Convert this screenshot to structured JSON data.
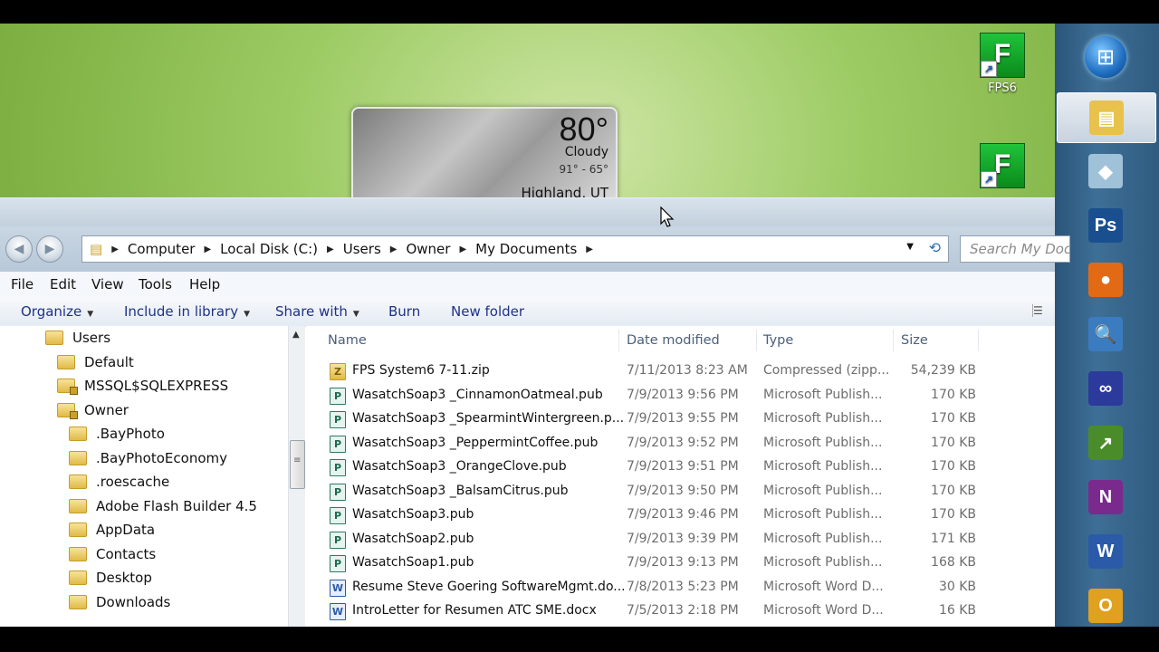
{
  "desktop": {
    "icons": [
      {
        "label": "FPS6",
        "glyph": "F"
      },
      {
        "label": "",
        "glyph": "F"
      }
    ],
    "weather": {
      "temp": "80°",
      "condition": "Cloudy",
      "range": "91° - 65°",
      "location": "Highland, UT"
    }
  },
  "taskbar": {
    "start_icon": "windows-orb-icon",
    "apps": [
      {
        "name": "windows-explorer-icon",
        "glyph": "▤",
        "color": "#e8c24a",
        "active": true
      },
      {
        "name": "eraser-app-icon",
        "glyph": "◆",
        "color": "#9fc2d9"
      },
      {
        "name": "photoshop-icon",
        "glyph": "Ps",
        "color": "#1a4f8f"
      },
      {
        "name": "firefox-icon",
        "glyph": "●",
        "color": "#e36a14"
      },
      {
        "name": "magnifier-icon",
        "glyph": "🔍",
        "color": "#3b7cc0"
      },
      {
        "name": "loop-app-icon",
        "glyph": "∞",
        "color": "#2b3a9b"
      },
      {
        "name": "excel-chart-icon",
        "glyph": "↗",
        "color": "#4a8c2a"
      },
      {
        "name": "onenote-icon",
        "glyph": "N",
        "color": "#7a2a8c"
      },
      {
        "name": "word-icon",
        "glyph": "W",
        "color": "#2a5aa8"
      },
      {
        "name": "outlook-icon",
        "glyph": "O",
        "color": "#e0a020"
      }
    ]
  },
  "explorer": {
    "breadcrumbs": [
      "Computer",
      "Local Disk (C:)",
      "Users",
      "Owner",
      "My Documents"
    ],
    "search_placeholder": "Search My Documents",
    "menu": [
      "File",
      "Edit",
      "View",
      "Tools",
      "Help"
    ],
    "commands": {
      "organize": "Organize",
      "include_in_library": "Include in library",
      "share_with": "Share with",
      "burn": "Burn",
      "new_folder": "New folder"
    },
    "tree": [
      {
        "label": "Users",
        "level": 0
      },
      {
        "label": "Default",
        "level": 1
      },
      {
        "label": "MSSQL$SQLEXPRESS",
        "level": 1,
        "locked": true
      },
      {
        "label": "Owner",
        "level": 1,
        "locked": true
      },
      {
        "label": ".BayPhoto",
        "level": 2
      },
      {
        "label": ".BayPhotoEconomy",
        "level": 2
      },
      {
        "label": ".roescache",
        "level": 2
      },
      {
        "label": "Adobe Flash Builder 4.5",
        "level": 2
      },
      {
        "label": "AppData",
        "level": 2
      },
      {
        "label": "Contacts",
        "level": 2
      },
      {
        "label": "Desktop",
        "level": 2
      },
      {
        "label": "Downloads",
        "level": 2
      }
    ],
    "columns": {
      "name": "Name",
      "date": "Date modified",
      "type": "Type",
      "size": "Size"
    },
    "files": [
      {
        "name": "FPS System6 7-11.zip",
        "date": "7/11/2013 8:23 AM",
        "type": "Compressed (zipp...",
        "size": "54,239 KB",
        "kind": "zip"
      },
      {
        "name": "WasatchSoap3 _CinnamonOatmeal.pub",
        "date": "7/9/2013 9:56 PM",
        "type": "Microsoft Publish...",
        "size": "170 KB",
        "kind": "pub"
      },
      {
        "name": "WasatchSoap3 _SpearmintWintergreen.p...",
        "date": "7/9/2013 9:55 PM",
        "type": "Microsoft Publish...",
        "size": "170 KB",
        "kind": "pub"
      },
      {
        "name": "WasatchSoap3 _PeppermintCoffee.pub",
        "date": "7/9/2013 9:52 PM",
        "type": "Microsoft Publish...",
        "size": "170 KB",
        "kind": "pub"
      },
      {
        "name": "WasatchSoap3 _OrangeClove.pub",
        "date": "7/9/2013 9:51 PM",
        "type": "Microsoft Publish...",
        "size": "170 KB",
        "kind": "pub"
      },
      {
        "name": "WasatchSoap3 _BalsamCitrus.pub",
        "date": "7/9/2013 9:50 PM",
        "type": "Microsoft Publish...",
        "size": "170 KB",
        "kind": "pub"
      },
      {
        "name": "WasatchSoap3.pub",
        "date": "7/9/2013 9:46 PM",
        "type": "Microsoft Publish...",
        "size": "170 KB",
        "kind": "pub"
      },
      {
        "name": "WasatchSoap2.pub",
        "date": "7/9/2013 9:39 PM",
        "type": "Microsoft Publish...",
        "size": "171 KB",
        "kind": "pub"
      },
      {
        "name": "WasatchSoap1.pub",
        "date": "7/9/2013 9:13 PM",
        "type": "Microsoft Publish...",
        "size": "168 KB",
        "kind": "pub"
      },
      {
        "name": "Resume Steve Goering SoftwareMgmt.do...",
        "date": "7/8/2013 5:23 PM",
        "type": "Microsoft Word D...",
        "size": "30 KB",
        "kind": "word"
      },
      {
        "name": "IntroLetter for Resumen ATC SME.docx",
        "date": "7/5/2013 2:18 PM",
        "type": "Microsoft Word D...",
        "size": "16 KB",
        "kind": "word"
      }
    ]
  }
}
